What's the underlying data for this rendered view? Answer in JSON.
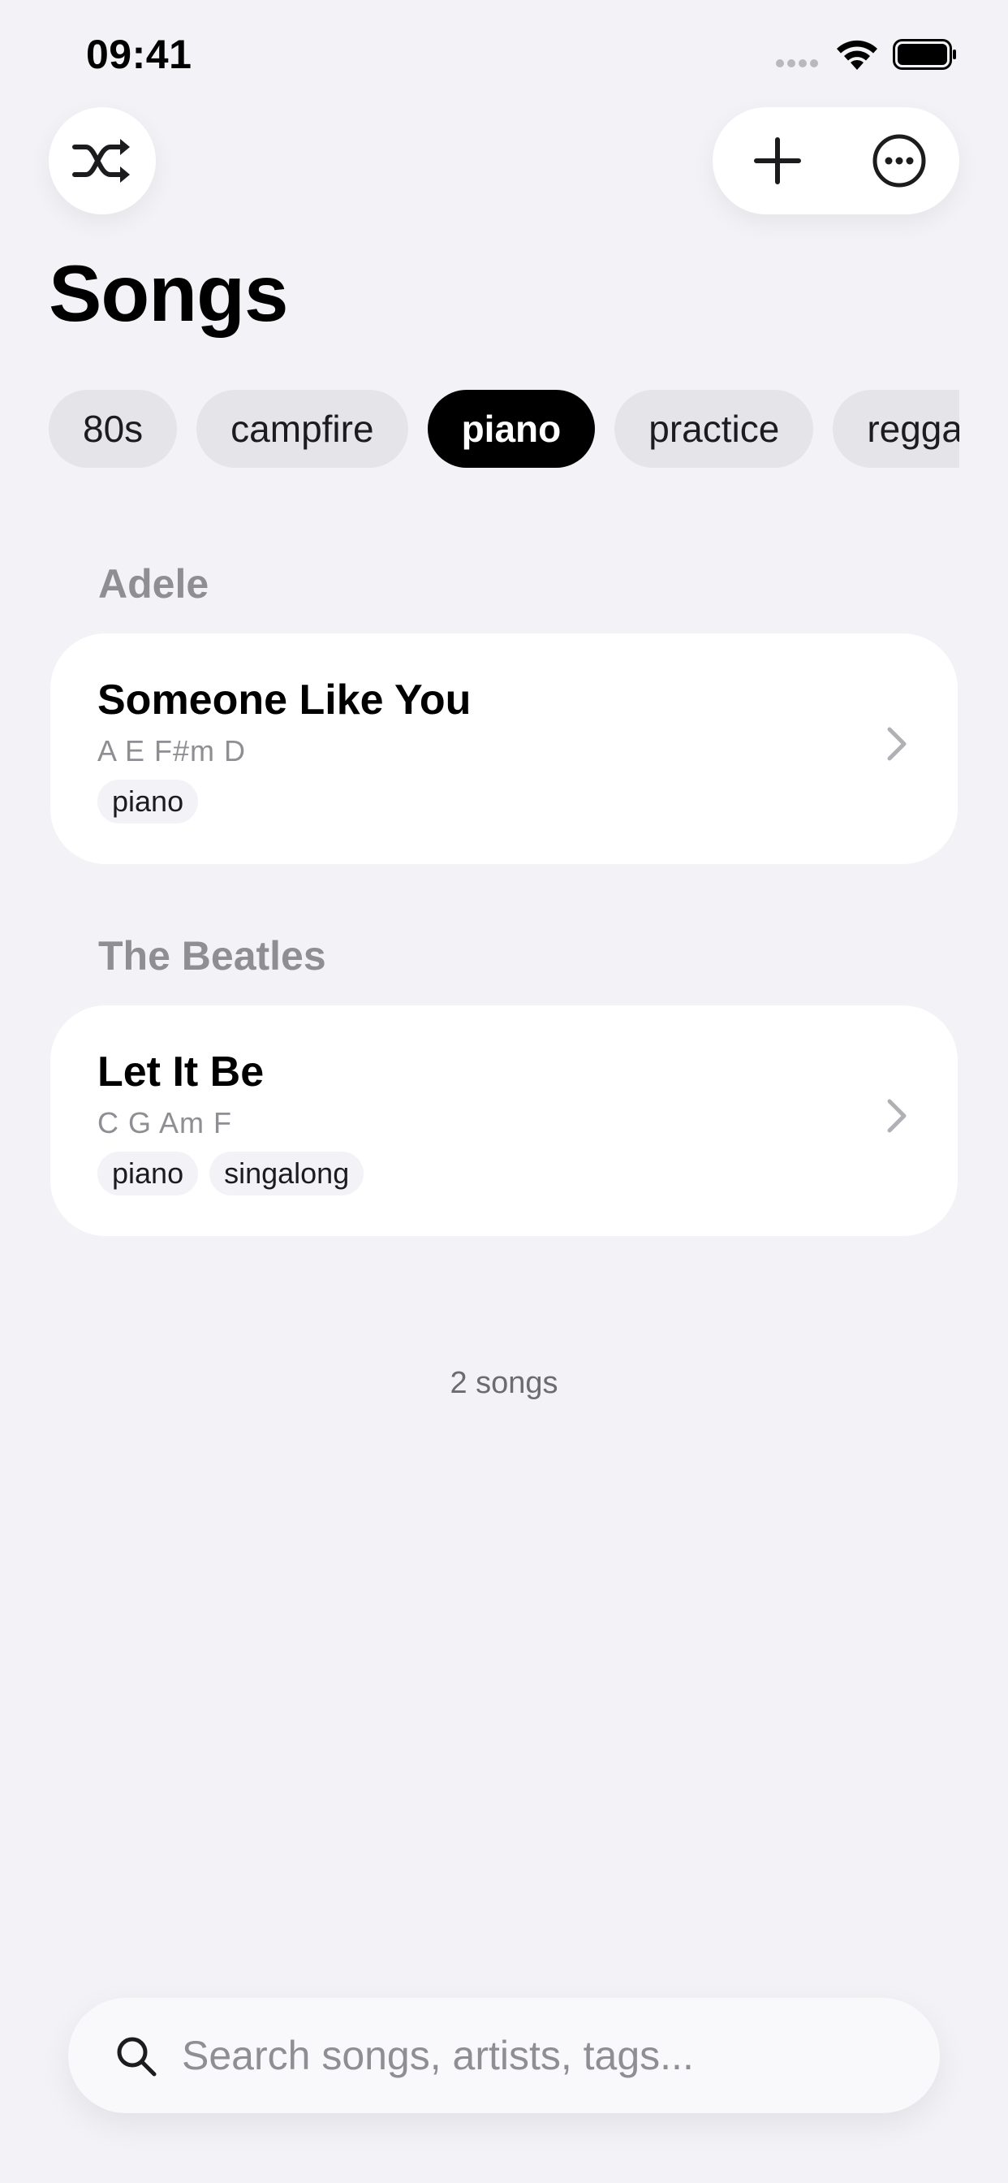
{
  "status_bar": {
    "time": "09:41"
  },
  "toolbar": {
    "shuffle_icon": "shuffle-icon",
    "add_icon": "plus-icon",
    "more_icon": "ellipsis-circle-icon"
  },
  "page": {
    "title": "Songs"
  },
  "tag_filters": [
    {
      "label": "80s",
      "selected": false
    },
    {
      "label": "campfire",
      "selected": false
    },
    {
      "label": "piano",
      "selected": true
    },
    {
      "label": "practice",
      "selected": false
    },
    {
      "label": "reggae",
      "selected": false
    }
  ],
  "sections": [
    {
      "artist": "Adele",
      "songs": [
        {
          "title": "Someone Like You",
          "chords": "A E F#m D",
          "tags": [
            "piano"
          ]
        }
      ]
    },
    {
      "artist": "The Beatles",
      "songs": [
        {
          "title": "Let It Be",
          "chords": "C G Am F",
          "tags": [
            "piano",
            "singalong"
          ]
        }
      ]
    }
  ],
  "footer": {
    "song_count": "2 songs"
  },
  "search": {
    "placeholder": "Search songs, artists, tags...",
    "value": ""
  },
  "colors": {
    "background": "#f2f2f7",
    "card": "#ffffff",
    "chip": "#e4e4e9",
    "chip_selected": "#000000",
    "secondary_text": "#8e8e93"
  }
}
